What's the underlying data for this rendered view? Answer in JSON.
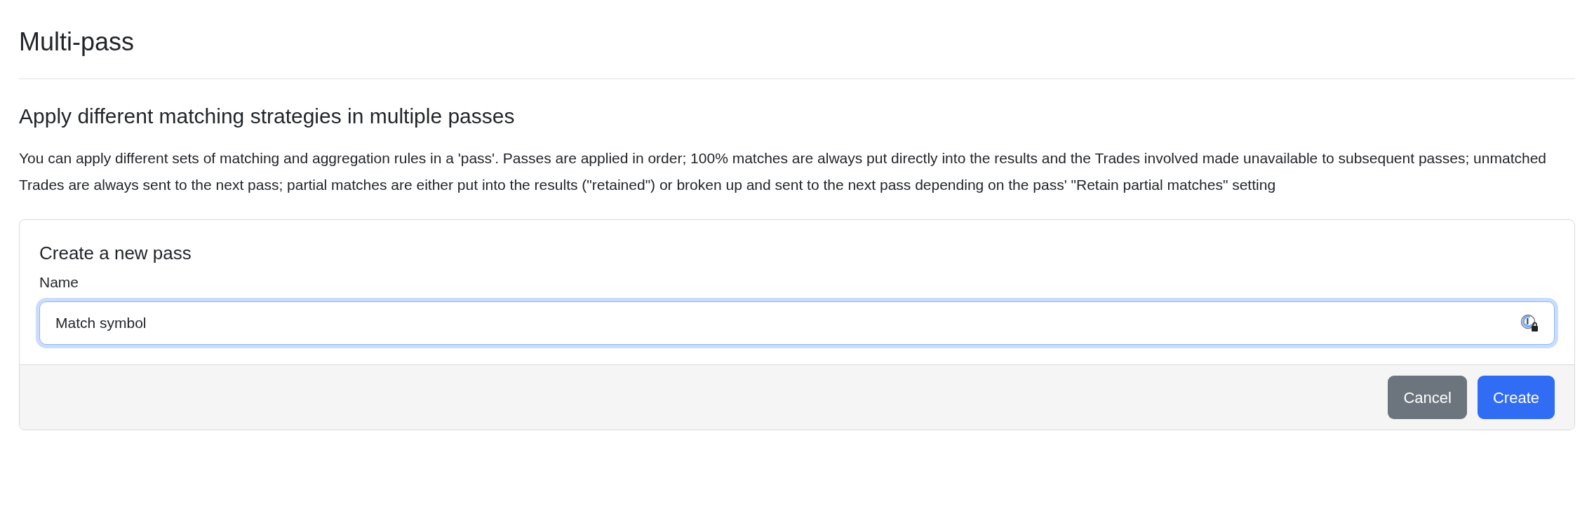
{
  "page": {
    "title": "Multi-pass"
  },
  "section": {
    "heading": "Apply different matching strategies in multiple passes",
    "description": "You can apply different sets of matching and aggregation rules in a 'pass'. Passes are applied in order; 100% matches are always put directly into the results and the Trades involved made unavailable to subsequent passes; unmatched Trades are always sent to the next pass; partial matches are either put into the results (\"retained\") or broken up and sent to the next pass depending on the pass' \"Retain partial matches\" setting"
  },
  "card": {
    "title": "Create a new pass",
    "field": {
      "label": "Name",
      "value": "Match symbol",
      "focused": true
    },
    "buttons": [
      {
        "label": "Cancel",
        "kind": "secondary"
      },
      {
        "label": "Create",
        "kind": "primary"
      }
    ]
  }
}
